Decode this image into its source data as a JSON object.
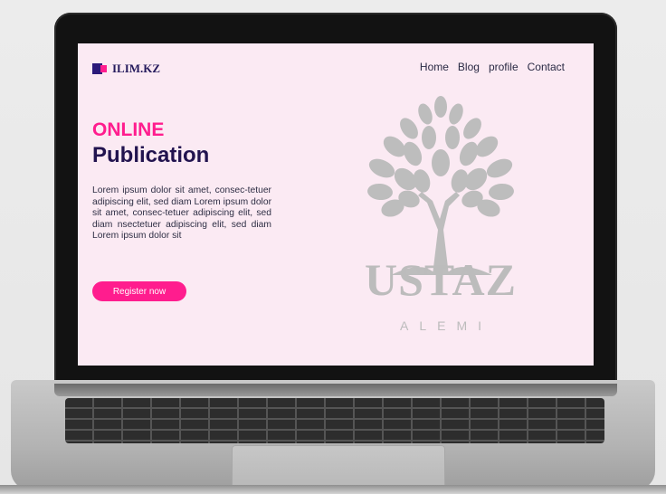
{
  "brand": {
    "name": "ILIM.KZ"
  },
  "nav": {
    "items": [
      "Home",
      "Blog",
      "profile",
      "Contact"
    ]
  },
  "hero": {
    "title": "ONLINE",
    "subtitle": "Publication",
    "body": "Lorem ipsum dolor sit amet, consec-tetuer adipiscing elit, sed diam Lorem ipsum dolor sit amet, consec-tetuer adipiscing elit, sed diam nsectetuer adipiscing elit, sed diam Lorem ipsum dolor sit",
    "cta": "Register now"
  },
  "logo": {
    "word": "USTAZ",
    "sub": "ALEMI",
    "icon": "tree-icon"
  },
  "colors": {
    "accent": "#ff1d8e",
    "navy": "#22134f",
    "screen_bg": "#fbeaf3",
    "logo_gray": "#bcbcbc"
  }
}
